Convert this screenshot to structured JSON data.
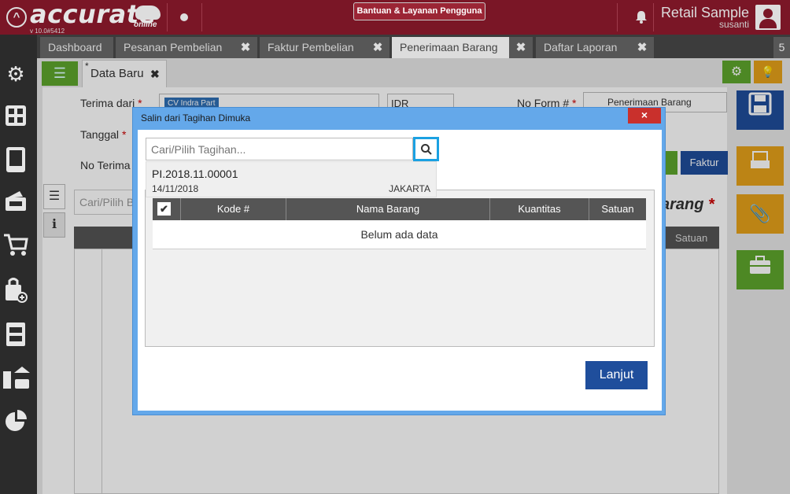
{
  "app": {
    "logo_text": "accurate",
    "logo_sub": "online",
    "version": "v 10.0#5412",
    "help_label": "Bantuan & Layanan Pengguna",
    "company": "Retail Sample",
    "user": "susanti"
  },
  "tabs": [
    {
      "label": "Dashboard"
    },
    {
      "label": "Pesanan Pembelian"
    },
    {
      "label": "Faktur Pembelian"
    },
    {
      "label": "Penerimaan Barang"
    },
    {
      "label": "Daftar Laporan"
    }
  ],
  "tab_count": "5",
  "doc_tab": {
    "label": "Data Baru",
    "modified_mark": "*"
  },
  "form": {
    "terima_dari_label": "Terima dari",
    "terima_dari_value": "CV Indra Part",
    "currency": "IDR",
    "no_form_label": "No Form #",
    "form_type": "Penerimaan Barang",
    "tanggal_label": "Tanggal",
    "no_terima_label": "No Terima",
    "faktur_label": "Faktur",
    "search_placeholder": "Cari/Pilih B",
    "barang_heading": "arang",
    "satuan_label": "Satuan"
  },
  "dialog": {
    "title": "Salin dari Tagihan Dimuka",
    "close": "×",
    "search_placeholder": "Cari/Pilih Tagihan...",
    "dropdown": {
      "code": "PI.2018.11.00001",
      "date": "14/11/2018",
      "location": "JAKARTA"
    },
    "columns": [
      "Kode #",
      "Nama Barang",
      "Kuantitas",
      "Satuan"
    ],
    "empty_text": "Belum ada data",
    "next_label": "Lanjut"
  }
}
